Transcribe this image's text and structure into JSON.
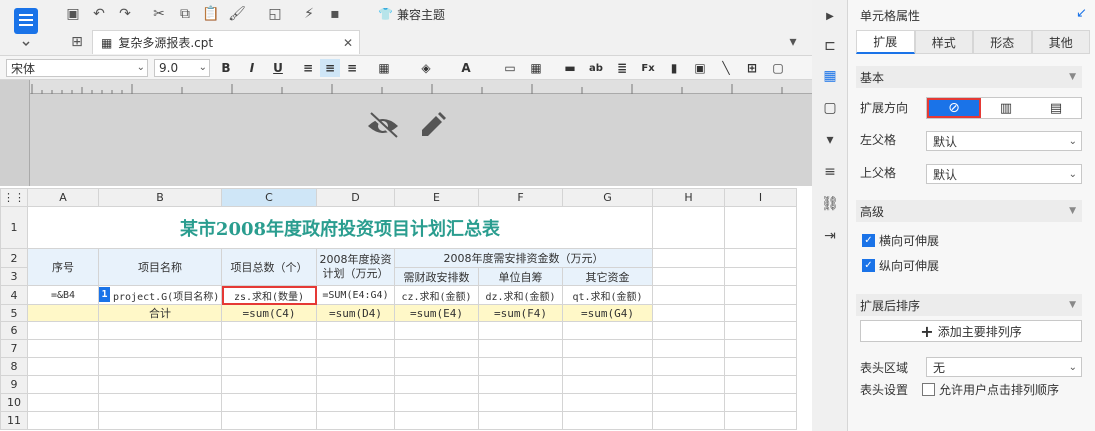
{
  "toolbar": {
    "compat_label": "兼容主题"
  },
  "tab": {
    "file_name": "复杂多源报表.cpt"
  },
  "format": {
    "font_name": "宋体",
    "font_size": "9.0"
  },
  "columns": [
    "A",
    "B",
    "C",
    "D",
    "E",
    "F",
    "G",
    "H",
    "I"
  ],
  "rows": [
    "1",
    "2",
    "3",
    "4",
    "5",
    "6",
    "7",
    "8",
    "9",
    "10",
    "11"
  ],
  "sheet": {
    "title": "某市2008年度政府投资项目计划汇总表",
    "h_seq": "序号",
    "h_name": "项目名称",
    "h_total": "项目总数（个）",
    "h_plan": "2008年度投资计划（万元）",
    "h_fund": "2008年度需安排资金数（万元）",
    "h_fin": "需财政安排数",
    "h_unit": "单位自筹",
    "h_other": "其它资金",
    "r4_a": "=&B4",
    "r4_b": "project.G(项目名称)",
    "r4_c": "zs.求和(数量)",
    "r4_d": "=SUM(E4:G4)",
    "r4_e": "cz.求和(金额)",
    "r4_f": "dz.求和(金额)",
    "r4_g": "qt.求和(金额)",
    "r5_b": "合计",
    "r5_c": "=sum(C4)",
    "r5_d": "=sum(D4)",
    "r5_e": "=sum(E4)",
    "r5_f": "=sum(F4)",
    "r5_g": "=sum(G4)"
  },
  "panel": {
    "title": "单元格属性",
    "tabs": [
      "扩展",
      "样式",
      "形态",
      "其他"
    ],
    "sec_basic": "基本",
    "expand_dir": "扩展方向",
    "left_parent": "左父格",
    "left_parent_val": "默认",
    "top_parent": "上父格",
    "top_parent_val": "默认",
    "sec_adv": "高级",
    "h_stretch": "横向可伸展",
    "v_stretch": "纵向可伸展",
    "sec_sort": "扩展后排序",
    "add_sort": "添加主要排列序",
    "header_area": "表头区域",
    "header_area_val": "无",
    "header_set": "表头设置",
    "allow_sort": "允许用户点击排列顺序"
  }
}
